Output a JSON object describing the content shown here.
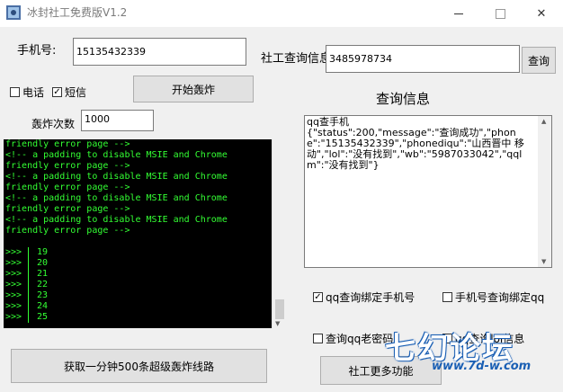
{
  "window": {
    "title": "冰封社工免费版V1.2",
    "icon": "app-icon",
    "minimize_glyph": "—",
    "close_glyph": "✕"
  },
  "phone": {
    "label": "手机号:",
    "value": "15135432339"
  },
  "social_query": {
    "label": "社工查询信息",
    "value": "3485978734",
    "button": "查询"
  },
  "options": {
    "call_label": "电话",
    "call_checked": false,
    "sms_label": "短信",
    "sms_checked": true
  },
  "start_button": "开始轰炸",
  "count": {
    "label": "轰炸次数",
    "value": "1000"
  },
  "console": {
    "lines": [
      "friendly error page -->",
      "<!-- a padding to disable MSIE and Chrome",
      "friendly error page -->",
      "<!-- a padding to disable MSIE and Chrome",
      "friendly error page -->",
      "<!-- a padding to disable MSIE and Chrome",
      "friendly error page -->",
      "<!-- a padding to disable MSIE and Chrome",
      "friendly error page -->"
    ],
    "prompt": ">>>",
    "numbers": [
      "19",
      "20",
      "21",
      "22",
      "23",
      "24",
      "25"
    ]
  },
  "info": {
    "heading": "查询信息",
    "content": "qq查手机\n{\"status\":200,\"message\":\"查询成功\",\"phone\":\"15135432339\",\"phonediqu\":\"山西晋中 移动\",\"lol\":\"没有找到\",\"wb\":\"5987033042\",\"qqlm\":\"没有找到\"}"
  },
  "checks": {
    "qq_bind_phone": {
      "label": "qq查询绑定手机号",
      "checked": true
    },
    "phone_bind_qq": {
      "label": "手机号查询绑定qq",
      "checked": false
    },
    "qq_old_password": {
      "label": "查询qq老密码",
      "checked": false
    },
    "qq_lol": {
      "label": "qq查询lol信息",
      "checked": false
    }
  },
  "bottom_buttons": {
    "get_lines": "获取一分钟500条超级轰炸线路",
    "more_features": "社工更多功能"
  },
  "watermark": {
    "text": "七幻论坛",
    "url": "www.7d-w.com"
  },
  "colors": {
    "console_bg": "#000000",
    "console_fg": "#33ff33",
    "watermark_blue": "#1a5fb4"
  }
}
